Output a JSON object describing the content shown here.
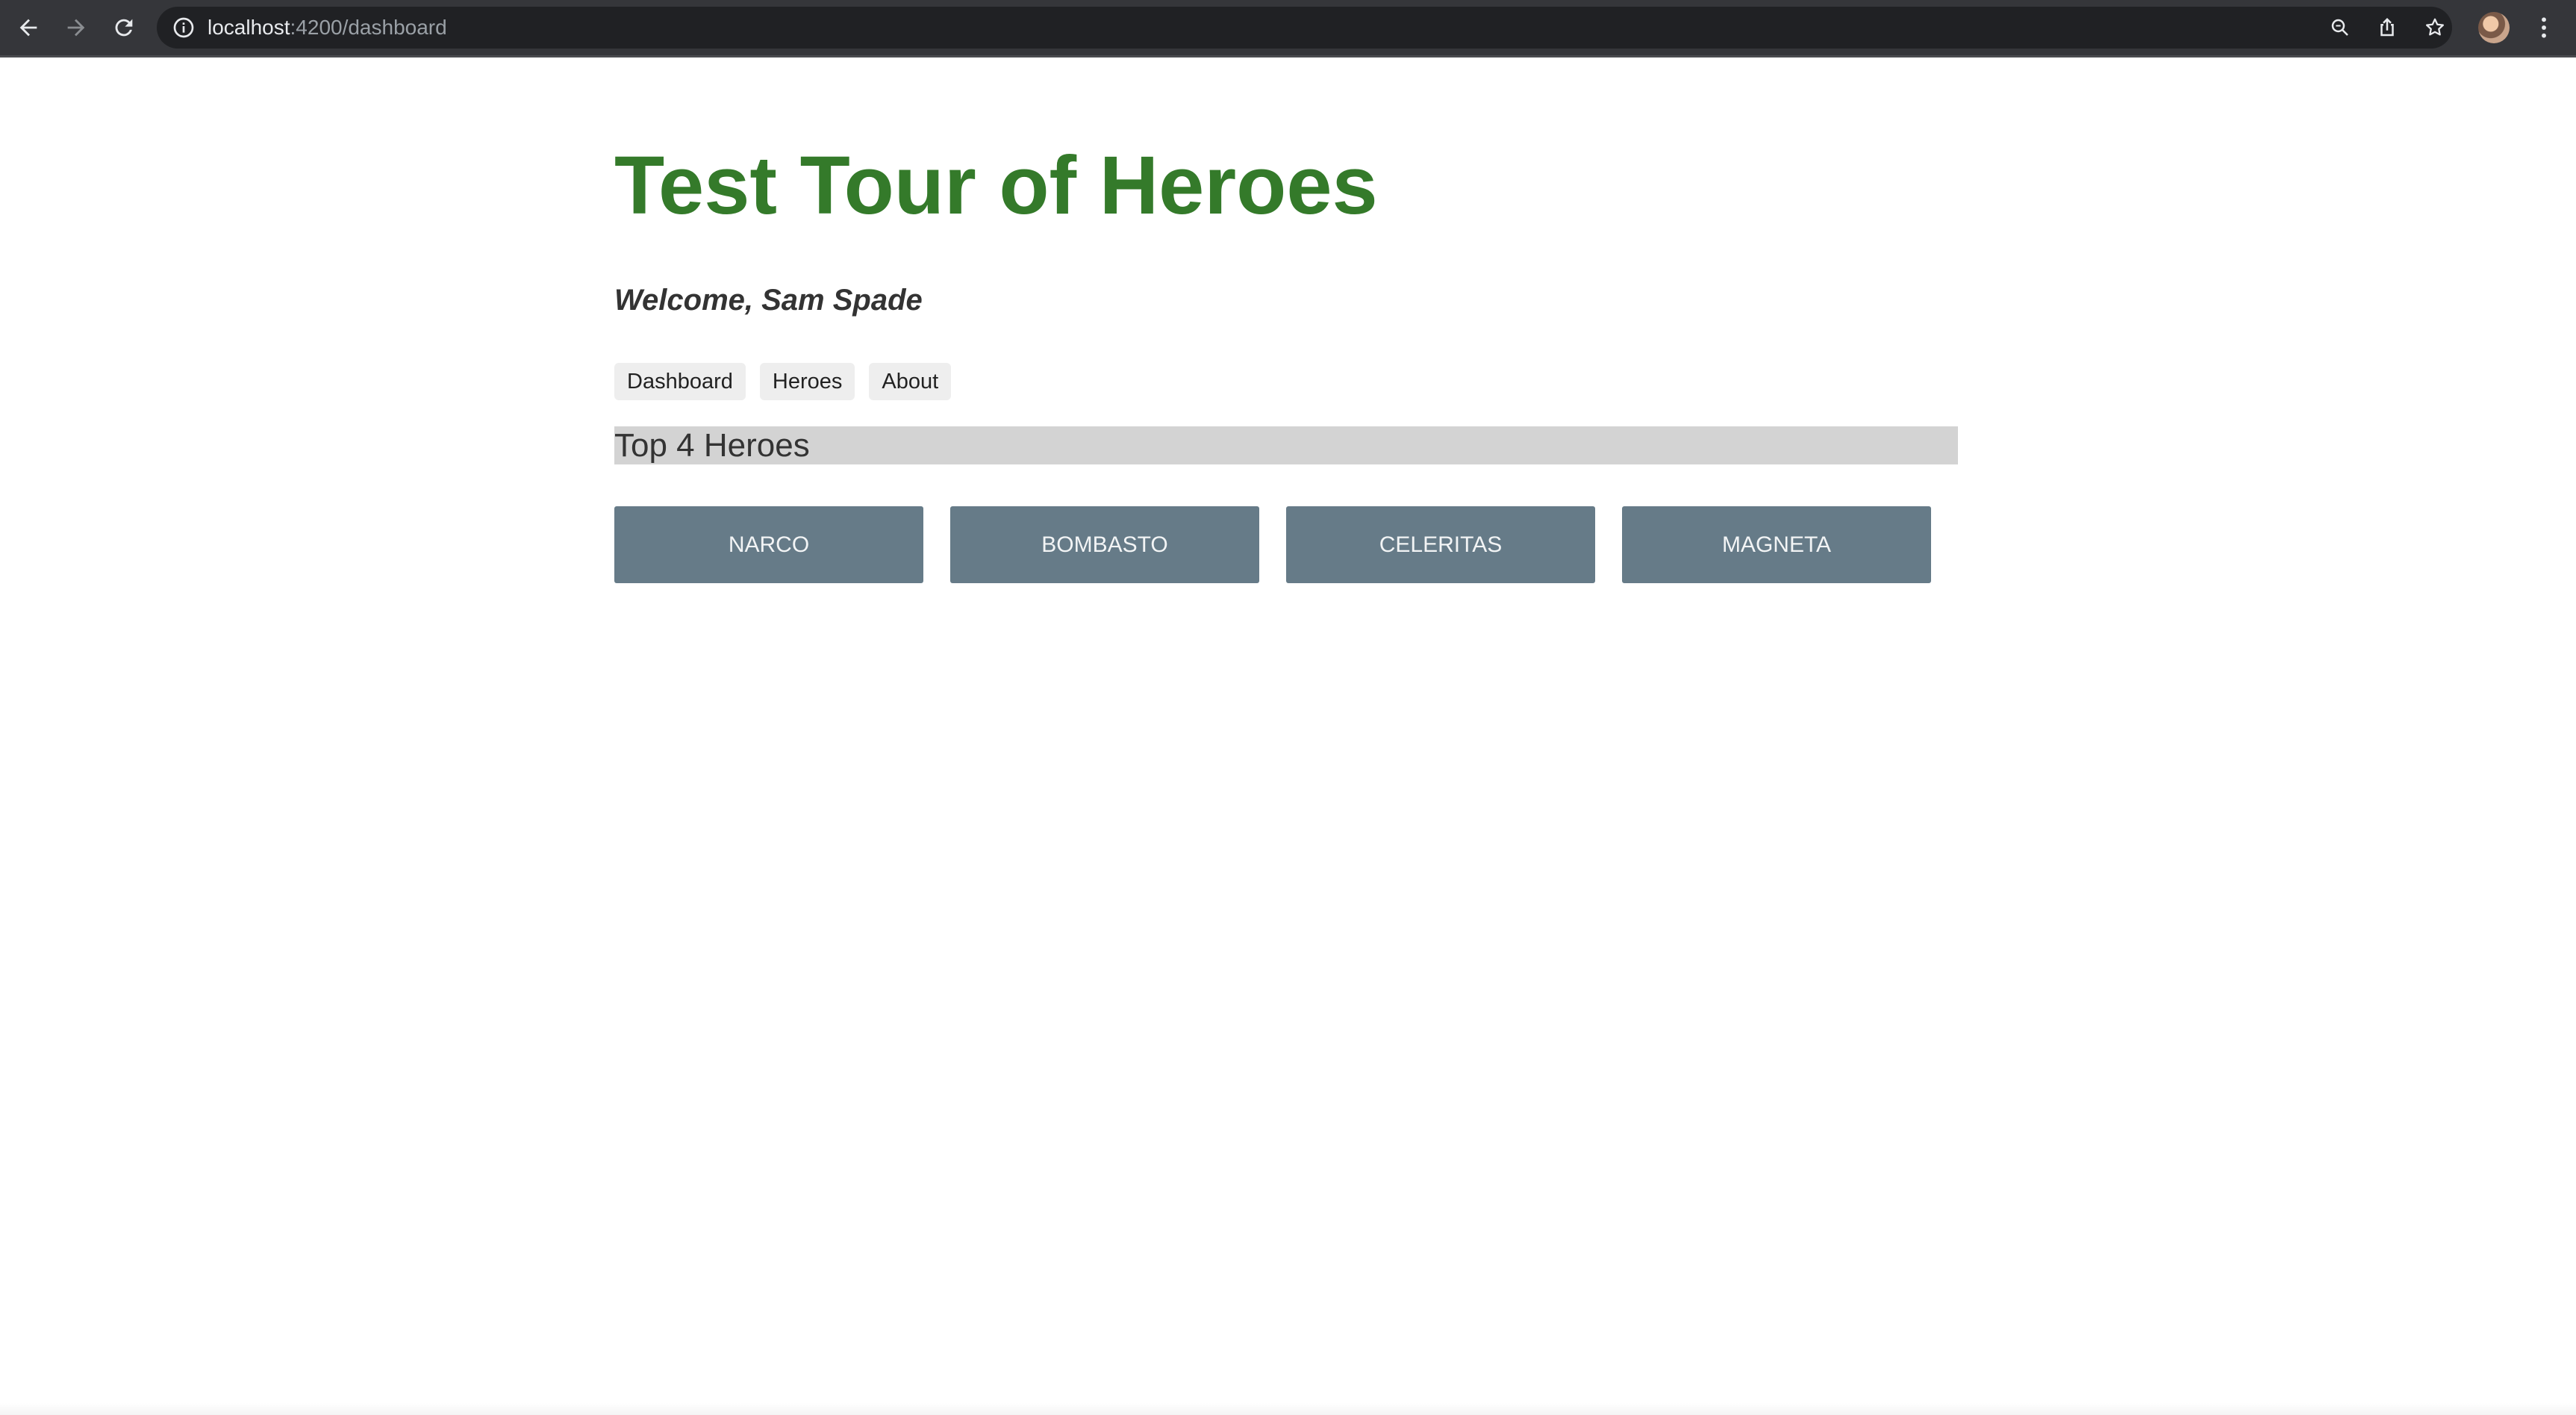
{
  "browser": {
    "url_host": "localhost",
    "url_path": ":4200/dashboard",
    "icons": [
      "back-icon",
      "forward-icon",
      "reload-icon",
      "info-icon",
      "zoom-icon",
      "share-icon",
      "bookmark-star-icon",
      "profile-avatar",
      "kebab-menu-icon"
    ]
  },
  "app": {
    "title": "Test Tour of Heroes",
    "welcome": "Welcome, Sam Spade",
    "title_color": "#347a2a"
  },
  "nav": {
    "items": [
      {
        "label": "Dashboard"
      },
      {
        "label": "Heroes"
      },
      {
        "label": "About"
      }
    ]
  },
  "dashboard": {
    "heading": "Top 4 Heroes",
    "heroes": [
      {
        "name": "NARCO"
      },
      {
        "name": "BOMBASTO"
      },
      {
        "name": "CELERITAS"
      },
      {
        "name": "MAGNETA"
      }
    ],
    "card_color": "#667b88"
  }
}
